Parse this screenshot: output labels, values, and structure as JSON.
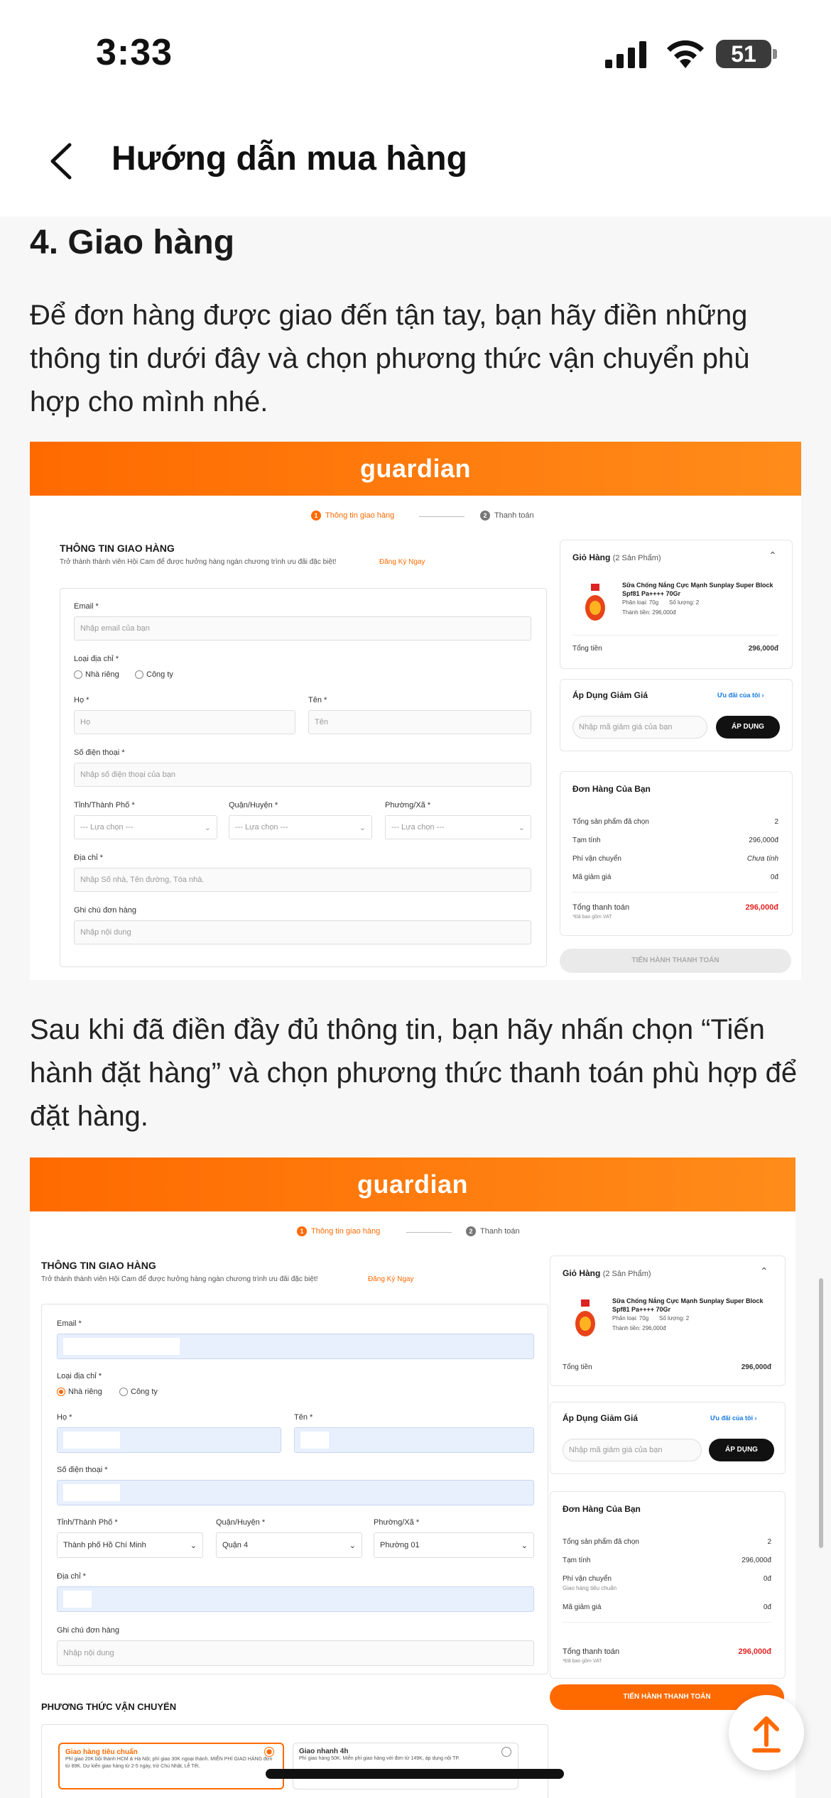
{
  "status": {
    "time": "3:33",
    "battery": "51"
  },
  "nav": {
    "title": "Hướng dẫn mua hàng"
  },
  "section": {
    "heading": "4. Giao hàng",
    "para1": "Để đơn hàng được giao đến tận tay, bạn hãy điền những thông tin dưới đây và chọn phương thức vận chuyển phù hợp cho mình nhé.",
    "para2": "Sau khi đã điền đầy đủ thông tin, bạn hãy nhấn chọn “Tiến hành đặt hàng” và chọn phương thức thanh toán phù hợp để đặt hàng."
  },
  "shot": {
    "brand": "guardian",
    "step1": "Thông tin giao hàng",
    "step2": "Thanh toán",
    "step1_num": "1",
    "step2_num": "2",
    "form_title": "THÔNG TIN GIAO HÀNG",
    "form_sub": "Trở thành thành viên Hội Cam để được hưởng hàng ngàn chương trình ưu đãi đặc biệt!",
    "register": "Đăng Ký Ngay",
    "email_label": "Email *",
    "email_ph": "Nhập email của bạn",
    "addr_type_label": "Loại địa chỉ *",
    "home": "Nhà riêng",
    "company": "Công ty",
    "lastname_label": "Họ *",
    "lastname_ph": "Họ",
    "firstname_label": "Tên *",
    "firstname_ph": "Tên",
    "phone_label": "Số điện thoại *",
    "phone_ph": "Nhập số điện thoại của bạn",
    "city_label": "Tỉnh/Thành Phố *",
    "district_label": "Quận/Huyện *",
    "ward_label": "Phường/Xã *",
    "select_ph": "--- Lựa chọn ---",
    "address_label": "Địa chỉ *",
    "address_ph": "Nhập Số nhà, Tên đường, Tòa nhà.",
    "note_label": "Ghi chú đơn hàng",
    "note_ph": "Nhập nội dung",
    "cart_title": "Giỏ Hàng",
    "cart_count": "(2 Sản Phẩm)",
    "product_name": "Sữa Chống Nắng Cực Mạnh Sunplay Super Block Spf81 Pa++++ 70Gr",
    "product_variant": "Phân loại: 70g",
    "product_qty": "Số lượng: 2",
    "product_price": "Thành tiền: 296,000đ",
    "total_label": "Tổng tiền",
    "total_value": "296,000đ",
    "discount_title": "Áp Dụng Giảm Giá",
    "discount_link": "Ưu đãi của tôi",
    "discount_ph": "Nhập mã giảm giá của bạn",
    "apply": "ÁP DỤNG",
    "order_title": "Đơn Hàng Của Bạn",
    "sum_items_label": "Tổng sản phẩm đã chọn",
    "sum_items_value": "2",
    "subtotal_label": "Tạm tính",
    "subtotal_value": "296,000đ",
    "ship_label": "Phí vận chuyển",
    "ship_value_1": "Chưa tính",
    "ship_value_2": "0đ",
    "ship_sub": "Giao hàng tiêu chuẩn",
    "coupon_label": "Mã giảm giá",
    "coupon_value": "0đ",
    "grand_label": "Tổng thanh toán",
    "grand_value": "296,000đ",
    "vat": "*Đã bao gồm VAT",
    "checkout": "TIẾN HÀNH THANH TOÁN",
    "city_value": "Thành phố Hồ Chí Minh",
    "district_value": "Quận 4",
    "ward_value": "Phường 01",
    "shipping_method": "PHƯƠNG THỨC VẬN CHUYỂN",
    "std_title": "Giao hàng tiêu chuẩn",
    "std_desc": "Phí giao 20K bội thành HCM & Hà Nội; phí giao 30K ngoại thành. MIỄN PHÍ GIAO HÀNG đơn từ 89K. Dự kiến giao hàng từ 2-5 ngày, trừ Chủ Nhật, Lễ Tết.",
    "fast_title": "Giao nhanh 4h",
    "fast_desc": "Phí giao hàng 50K. Miễn phí giao hàng với đơn từ 149K, áp dụng nội TP."
  },
  "colors": {
    "accent": "#ff6a00",
    "price": "#e52222",
    "page_bg": "#f7f7f7"
  }
}
